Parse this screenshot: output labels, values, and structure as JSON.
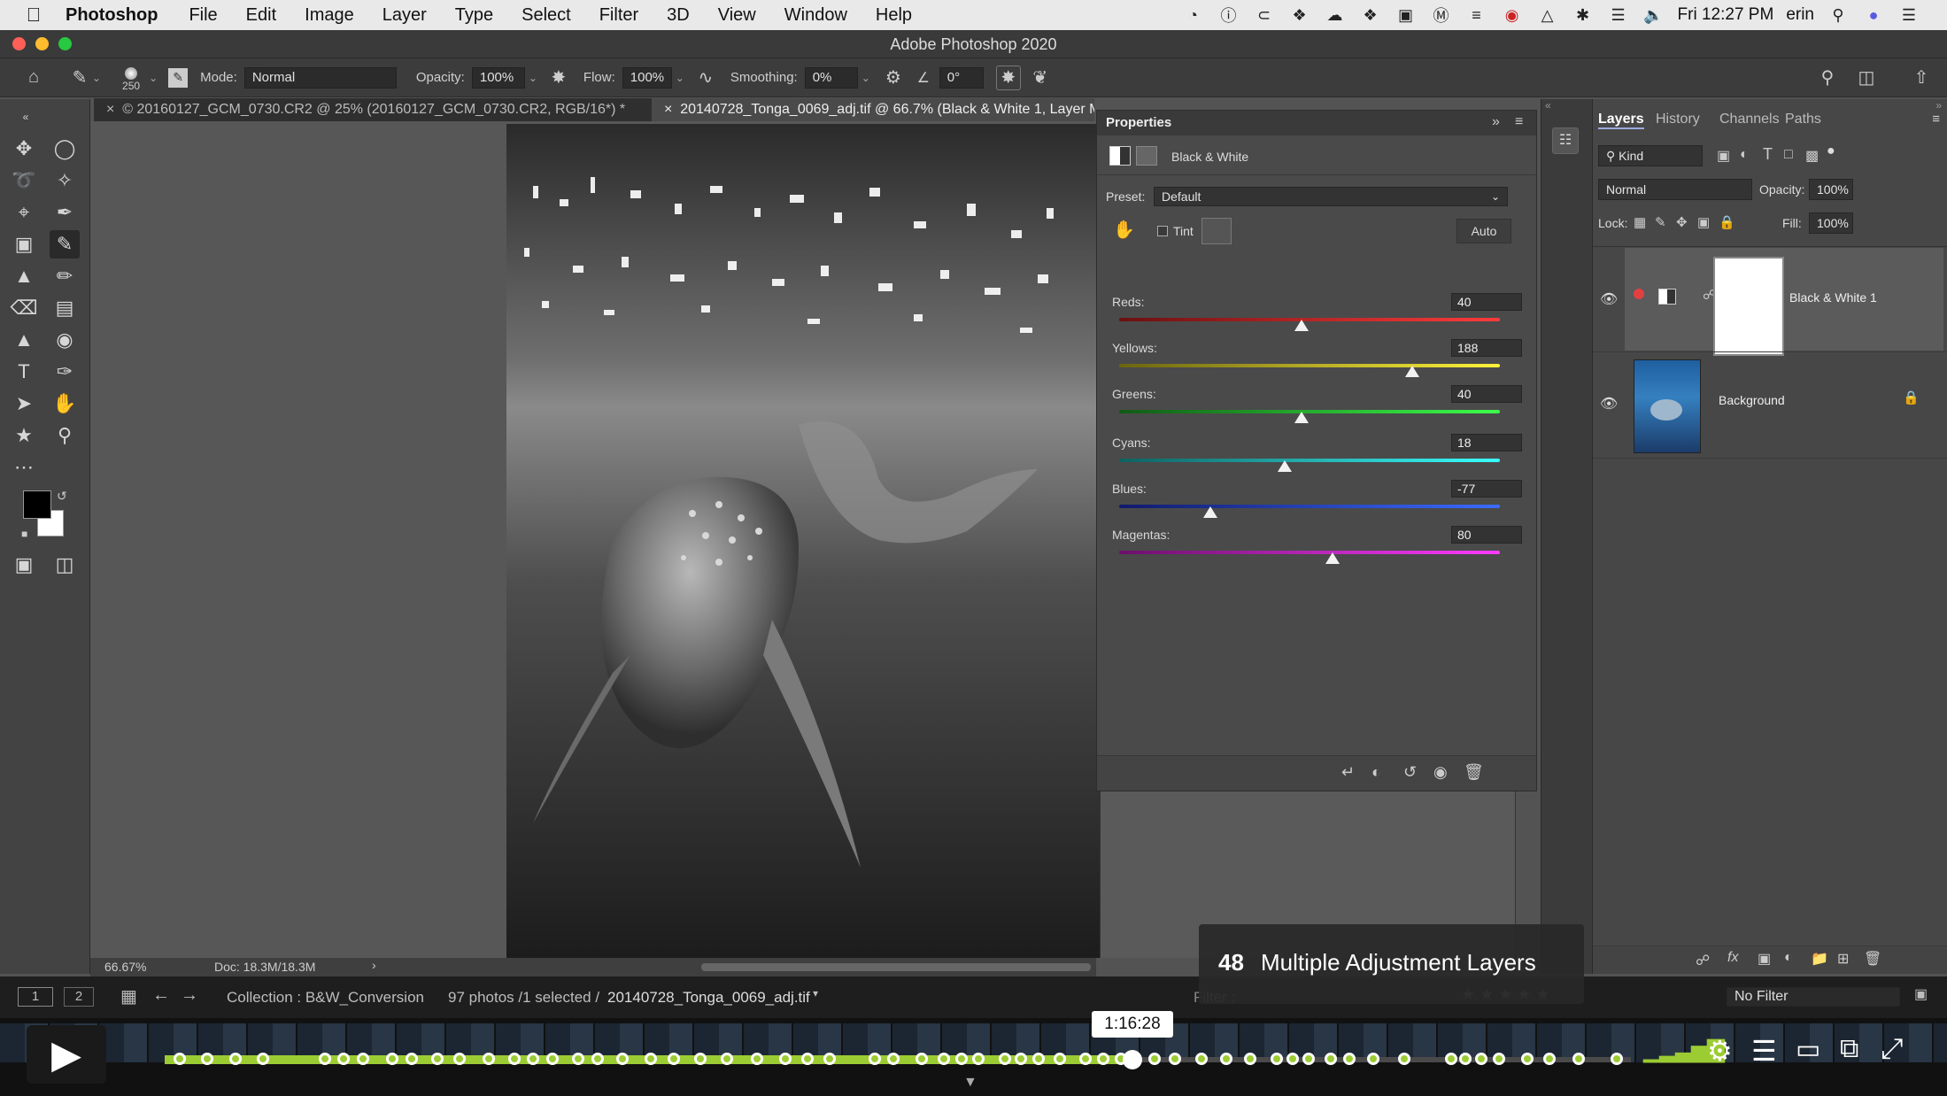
{
  "menubar": {
    "app_name": "Photoshop",
    "items": [
      "File",
      "Edit",
      "Image",
      "Layer",
      "Type",
      "Select",
      "Filter",
      "3D",
      "View",
      "Window",
      "Help"
    ],
    "clock": "Fri 12:27 PM",
    "user": "erin"
  },
  "window": {
    "title": "Adobe Photoshop 2020"
  },
  "options": {
    "brush_size": "250",
    "mode_label": "Mode:",
    "mode_value": "Normal",
    "opacity_label": "Opacity:",
    "opacity_value": "100%",
    "flow_label": "Flow:",
    "flow_value": "100%",
    "smoothing_label": "Smoothing:",
    "smoothing_value": "0%",
    "angle_value": "0°"
  },
  "tabs": [
    {
      "label": "© 20160127_GCM_0730.CR2 @ 25% (20160127_GCM_0730.CR2, RGB/16*) *"
    },
    {
      "label": "20140728_Tonga_0069_adj.tif @ 66.7% (Black & White 1, Layer Mask/16) *"
    }
  ],
  "status": {
    "zoom": "66.67%",
    "doc": "Doc: 18.3M/18.3M"
  },
  "properties": {
    "title": "Properties",
    "adjustment_name": "Black & White",
    "preset_label": "Preset:",
    "preset_value": "Default",
    "tint_label": "Tint",
    "auto_label": "Auto",
    "sliders": [
      {
        "label": "Reds:",
        "value": "40",
        "pos": 0.48,
        "colors": [
          "#6b1010",
          "#ff3b3b"
        ]
      },
      {
        "label": "Yellows:",
        "value": "188",
        "pos": 0.77,
        "colors": [
          "#6b6410",
          "#fff23b"
        ]
      },
      {
        "label": "Greens:",
        "value": "40",
        "pos": 0.48,
        "colors": [
          "#105a14",
          "#3bff4a"
        ]
      },
      {
        "label": "Cyans:",
        "value": "18",
        "pos": 0.435,
        "colors": [
          "#106060",
          "#3bffff"
        ]
      },
      {
        "label": "Blues:",
        "value": "-77",
        "pos": 0.24,
        "colors": [
          "#101a6b",
          "#3b6bff"
        ]
      },
      {
        "label": "Magentas:",
        "value": "80",
        "pos": 0.56,
        "colors": [
          "#6b106b",
          "#ff3bff"
        ]
      }
    ]
  },
  "layers_panel": {
    "tabs": [
      "Layers",
      "History",
      "Channels",
      "Paths"
    ],
    "kind_label": "Kind",
    "blend_mode": "Normal",
    "opacity_label": "Opacity:",
    "opacity_value": "100%",
    "lock_label": "Lock:",
    "fill_label": "Fill:",
    "fill_value": "100%",
    "layers": [
      {
        "name": "Black & White 1"
      },
      {
        "name": "Background"
      }
    ]
  },
  "lightroom": {
    "page_1": "1",
    "page_2": "2",
    "collection": "Collection : B&W_Conversion",
    "count": "97 photos /1 selected /",
    "filename": "20140728_Tonga_0069_adj.tif",
    "filter_label": "Filter :",
    "no_filter": "No Filter"
  },
  "video": {
    "chapter_number": "48",
    "chapter_title": "Multiple Adjustment Layers",
    "timecode": "1:16:28",
    "progress": 0.66
  }
}
